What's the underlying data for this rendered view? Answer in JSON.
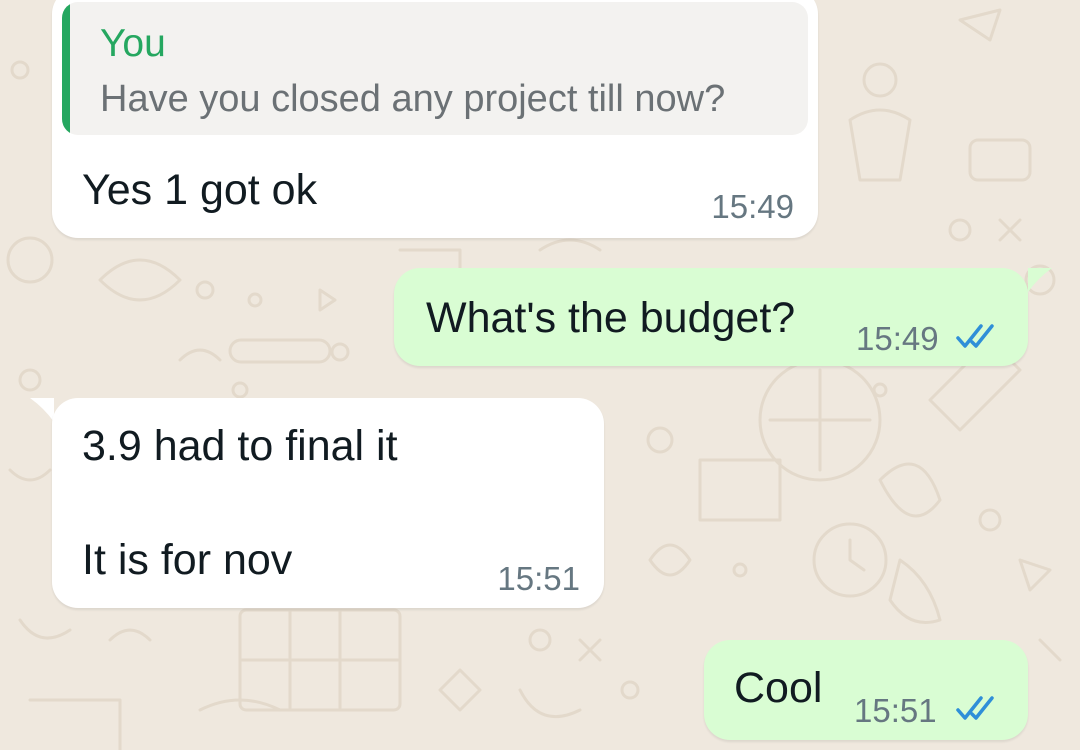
{
  "chat": {
    "messages": [
      {
        "direction": "incoming",
        "quoted": {
          "author": "You",
          "text": "Have you closed any project till now?"
        },
        "text": "Yes 1 got ok",
        "time": "15:49"
      },
      {
        "direction": "outgoing",
        "text": "What's the budget?",
        "time": "15:49",
        "status": "read"
      },
      {
        "direction": "incoming",
        "lines": [
          "3.9 had to final it",
          "It is for nov"
        ],
        "time": "15:51"
      },
      {
        "direction": "outgoing",
        "text": "Cool",
        "time": "15:51",
        "status": "read"
      }
    ]
  },
  "colors": {
    "wallpaper": "#efe8de",
    "incoming_bubble": "#ffffff",
    "outgoing_bubble": "#d9fdd3",
    "quote_accent": "#25a760",
    "read_ticks": "#53bdeb",
    "timestamp": "#667781"
  },
  "icons": {
    "read_receipt": "double-check-icon"
  }
}
